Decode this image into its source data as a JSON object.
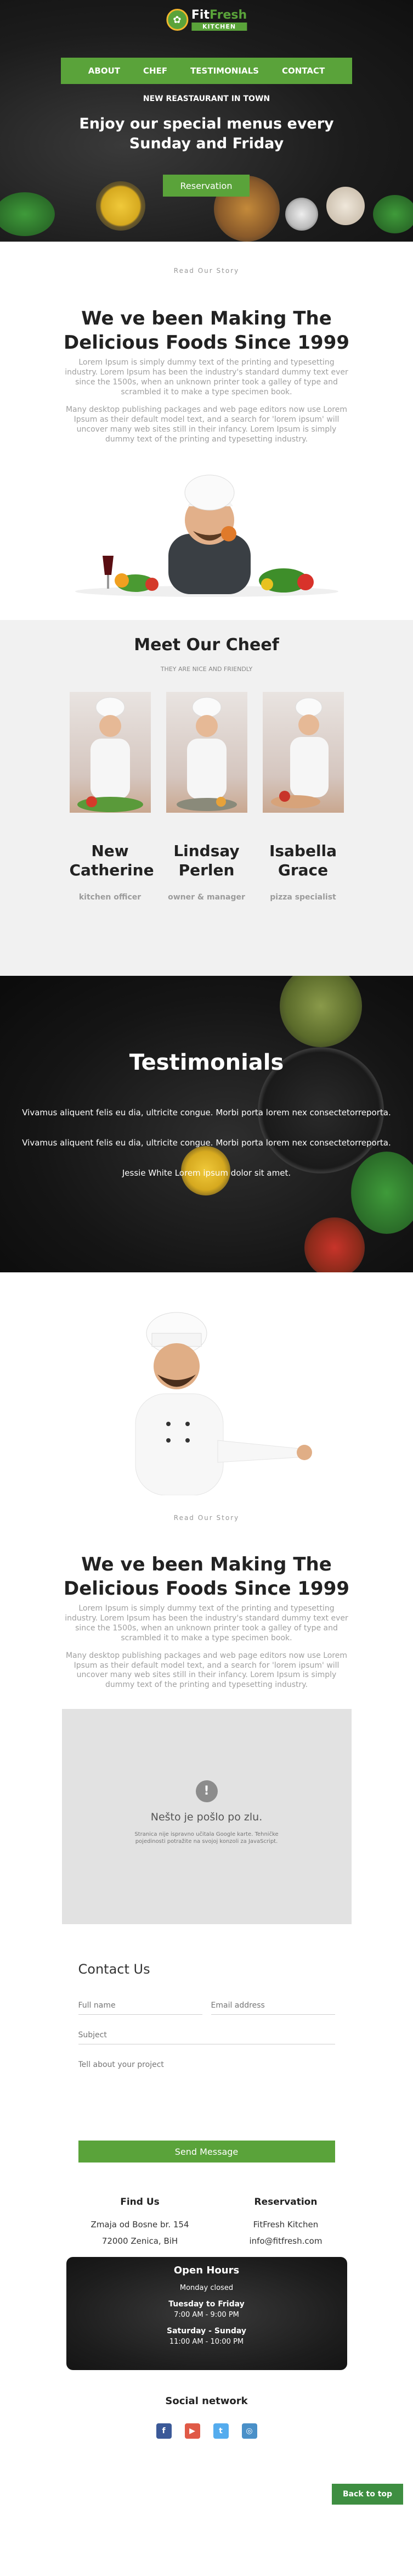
{
  "header": {
    "logo_text_1": "Fit",
    "logo_text_2": "Fresh",
    "logo_sub": "KITCHEN",
    "nav": [
      "ABOUT",
      "CHEF",
      "TESTIMONIALS",
      "CONTACT"
    ],
    "kicker": "NEW REASTAURANT IN TOWN",
    "title": "Enjoy our special menus every Sunday and Friday",
    "cta": "Reservation"
  },
  "story": {
    "kicker": "Read Our Story",
    "title": "We ve been Making The Delicious Foods Since 1999",
    "p1": "Lorem Ipsum is simply dummy text of the printing and typesetting industry. Lorem Ipsum has been the industry's standard dummy text ever since the 1500s, when an unknown printer took a galley of type and scrambled it to make a type specimen book.",
    "p2": "Many desktop publishing packages and web page editors now use Lorem Ipsum as their default model text, and a search for 'lorem ipsum' will uncover many web sites still in their infancy. Lorem Ipsum is simply dummy text of the printing and typesetting industry."
  },
  "meet": {
    "title": "Meet Our Cheef",
    "tagline": "THEY ARE NICE AND FRIENDLY",
    "chefs": [
      {
        "name": "New Catherine",
        "role": "kitchen officer"
      },
      {
        "name": "Lindsay Perlen",
        "role": "owner & manager"
      },
      {
        "name": "Isabella Grace",
        "role": "pizza specialist"
      }
    ]
  },
  "testimonials": {
    "title": "Testimonials",
    "q1": "Vivamus aliquent felis eu dia, ultricite congue. Morbi porta lorem nex consectetorreporta.",
    "q2": "Vivamus aliquent felis eu dia, ultricite congue. Morbi porta lorem nex consectetorreporta.",
    "author": "Jessie White Lorem ipsum dolor sit amet."
  },
  "story2": {
    "kicker": "Read Our Story",
    "title": "We ve been Making The Delicious Foods Since 1999",
    "p1": "Lorem Ipsum is simply dummy text of the printing and typesetting industry. Lorem Ipsum has been the industry's standard dummy text ever since the 1500s, when an unknown printer took a galley of type and scrambled it to make a type specimen book.",
    "p2": "Many desktop publishing packages and web page editors now use Lorem Ipsum as their default model text, and a search for 'lorem ipsum' will uncover many web sites still in their infancy. Lorem Ipsum is simply dummy text of the printing and typesetting industry."
  },
  "map": {
    "error_title": "Nešto je pošlo po zlu.",
    "error_text": "Stranica nije ispravno učitala Google karte. Tehničke pojedinosti potražite na svojoj konzoli za JavaScript."
  },
  "contact": {
    "title": "Contact Us",
    "full_name_placeholder": "Full name",
    "email_placeholder": "Email address",
    "subject_placeholder": "Subject",
    "message_placeholder": "Tell about your project",
    "send": "Send Message"
  },
  "find": {
    "title": "Find Us",
    "line1": "Zmaja od Bosne br. 154",
    "line2": "72000 Zenica, BiH"
  },
  "reservation": {
    "title": "Reservation",
    "line1": "FitFresh Kitchen",
    "line2": "info@fitfresh.com"
  },
  "hours": {
    "title": "Open Hours",
    "closed": "Monday closed",
    "day1": "Tuesday to Friday",
    "time1": "7:00 AM - 9:00 PM",
    "day2": "Saturday - Sunday",
    "time2": "11:00 AM - 10:00 PM"
  },
  "social": {
    "title": "Social network",
    "icons": [
      "facebook-icon",
      "youtube-icon",
      "twitter-icon",
      "instagram-icon"
    ],
    "colors": [
      "#3b5998",
      "#e05a47",
      "#55acee",
      "#4a90c8"
    ]
  },
  "back_to_top": "Back to top",
  "colors": {
    "accent": "#5aa33a",
    "dark": "#1c1c1c"
  }
}
